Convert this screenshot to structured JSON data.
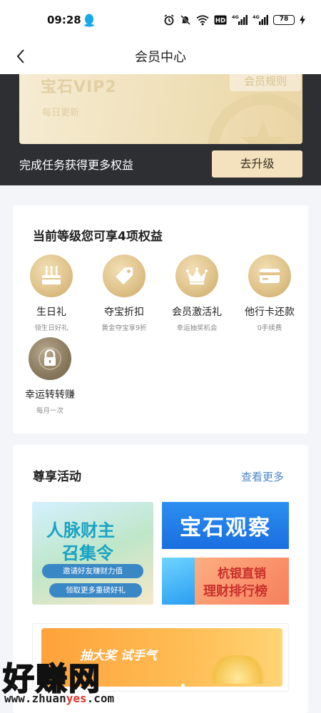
{
  "status_bar": {
    "time": "09:28",
    "icons": [
      "qq-icon",
      "alarm-icon",
      "mute-icon",
      "wifi-icon",
      "hd-icon",
      "signal-icon",
      "signal-icon",
      "charging-icon"
    ],
    "hd": "HD",
    "net1": "4G",
    "net2": "4G",
    "battery": "78"
  },
  "nav": {
    "title": "会员中心",
    "back_icon": "chevron-left-icon"
  },
  "member": {
    "level": "宝石VIP2",
    "update_note": "每日更新",
    "rules_label": "会员规则",
    "task_text": "完成任务获得更多权益",
    "upgrade_label": "去升级"
  },
  "benefits": {
    "title": "当前等级您可享4项权益",
    "items": [
      {
        "name": "生日礼",
        "desc": "领生日好礼",
        "icon": "birthday-cake-icon"
      },
      {
        "name": "夺宝折扣",
        "desc": "黄金夺宝享9折",
        "icon": "discount-tag-icon"
      },
      {
        "name": "会员激活礼",
        "desc": "幸运抽奖机会",
        "icon": "crown-icon"
      },
      {
        "name": "他行卡还款",
        "desc": "0手续费",
        "icon": "bank-card-icon"
      },
      {
        "name": "幸运转转赚",
        "desc": "每月一次",
        "icon": "lock-icon"
      }
    ]
  },
  "activities": {
    "title": "尊享活动",
    "more_label": "查看更多",
    "banner1": {
      "line1": "人脉财主",
      "line2": "召集令",
      "pill1": "邀请好友赚财力值",
      "pill2": "领取更多重磅好礼"
    },
    "banner2": {
      "text": "宝石观察"
    },
    "banner3": {
      "line1": "杭银直销",
      "line2": "理财排行榜"
    },
    "banner4": {
      "text": "抽大奖 试手气"
    }
  },
  "watermark": {
    "logo": "好赚网",
    "url_prefix": "www.zhuan",
    "url_highlight": "yes",
    "url_suffix": ".com"
  },
  "colors": {
    "accent_gold": "#e0c48c",
    "header_dark": "#2d2f33",
    "link_blue": "#4a86c8"
  }
}
